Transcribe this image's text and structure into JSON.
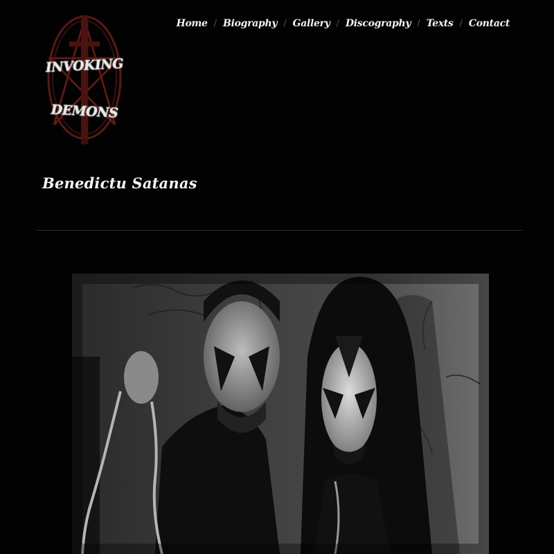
{
  "site": {
    "logo": {
      "line1": "INVOKING",
      "line2": "DEMONS"
    }
  },
  "nav": {
    "items": [
      {
        "label": "Home"
      },
      {
        "label": "Biography"
      },
      {
        "label": "Gallery"
      },
      {
        "label": "Discography"
      },
      {
        "label": "Texts"
      },
      {
        "label": "Contact"
      }
    ],
    "separator": "/"
  },
  "main": {
    "title": "Benedictu Satanas"
  },
  "colors": {
    "background": "#020202",
    "text": "#f4f4f4",
    "divider": "#2c2c2c",
    "logo_accent": "#6b1a10"
  }
}
